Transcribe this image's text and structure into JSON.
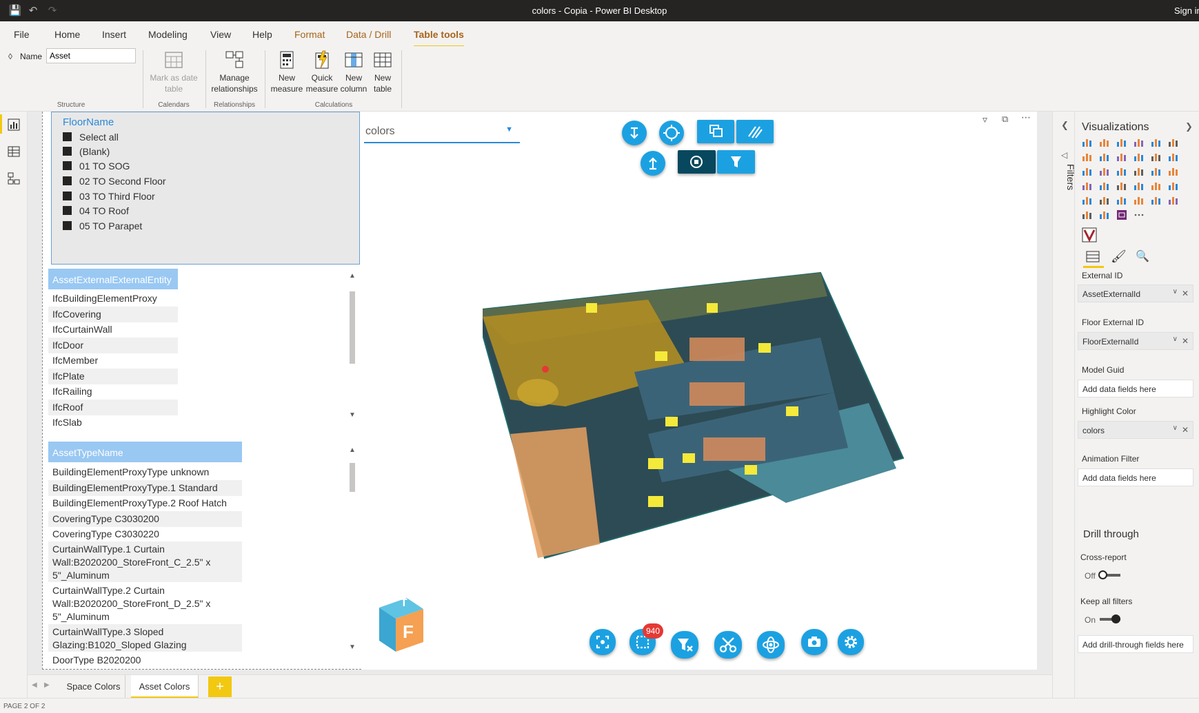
{
  "window": {
    "title": "colors - Copia - Power BI Desktop",
    "signin": "Sign in"
  },
  "menu": {
    "items": [
      "File",
      "Home",
      "Insert",
      "Modeling",
      "View",
      "Help",
      "Format",
      "Data / Drill",
      "Table tools"
    ]
  },
  "ribbon": {
    "name_label": "Name",
    "name_value": "Asset",
    "mark_date": "Mark as date table",
    "manage_rel": "Manage relationships",
    "new_measure": "New measure",
    "quick_measure": "Quick measure",
    "new_column": "New column",
    "new_table": "New table",
    "groups": {
      "structure": "Structure",
      "calendars": "Calendars",
      "relationships": "Relationships",
      "calculations": "Calculations"
    }
  },
  "floor_slicer": {
    "title": "FloorName",
    "items": [
      "Select all",
      "(Blank)",
      "01 TO SOG",
      "02 TO Second Floor",
      "03 TO Third Floor",
      "04 TO Roof",
      "05 TO Parapet"
    ]
  },
  "entity_list": {
    "header": "AssetExternalExternalEntity",
    "items": [
      "IfcBuildingElementProxy",
      "IfcCovering",
      "IfcCurtainWall",
      "IfcDoor",
      "IfcMember",
      "IfcPlate",
      "IfcRailing",
      "IfcRoof",
      "IfcSlab"
    ]
  },
  "type_list": {
    "header": "AssetTypeName",
    "items": [
      "BuildingElementProxyType unknown",
      "BuildingElementProxyType.1 Standard",
      "BuildingElementProxyType.2 Roof Hatch",
      "CoveringType C3030200",
      "CoveringType C3030220",
      "CurtainWallType.1 Curtain Wall:B2020200_StoreFront_C_2.5\" x 5\"_Aluminum",
      "CurtainWallType.2 Curtain Wall:B2020200_StoreFront_D_2.5\" x 5\"_Aluminum",
      "CurtainWallType.3 Sloped Glazing:B1020_Sloped Glazing",
      "DoorType B2020200"
    ]
  },
  "viewer": {
    "dropdown_value": "colors",
    "selection_count": "940",
    "cube_face": "F",
    "cube_top": "T"
  },
  "tabs": {
    "items": [
      "Space Colors",
      "Asset Colors"
    ],
    "active": "Asset Colors",
    "add": "+"
  },
  "status": {
    "page": "PAGE 2 OF 2"
  },
  "filters": {
    "label": "Filters"
  },
  "viz": {
    "title": "Visualizations",
    "fields": [
      {
        "label": "External ID",
        "value": "AssetExternalId"
      },
      {
        "label": "Floor External ID",
        "value": "FloorExternalId"
      },
      {
        "label": "Model Guid",
        "value": "Add data fields here"
      },
      {
        "label": "Highlight Color",
        "value": "colors"
      },
      {
        "label": "Animation Filter",
        "value": "Add data fields here"
      }
    ],
    "drill_title": "Drill through",
    "cross_report": "Cross-report",
    "cross_state": "Off",
    "keep_filters": "Keep all filters",
    "keep_state": "On",
    "drill_fields": "Add drill-through fields here"
  },
  "colors": {
    "accent": "#f2c811",
    "viewer_button": "#1ba1e2",
    "viewer_dark": "#07485e",
    "slicer_header": "#99c8f3",
    "badge": "#e53935"
  }
}
